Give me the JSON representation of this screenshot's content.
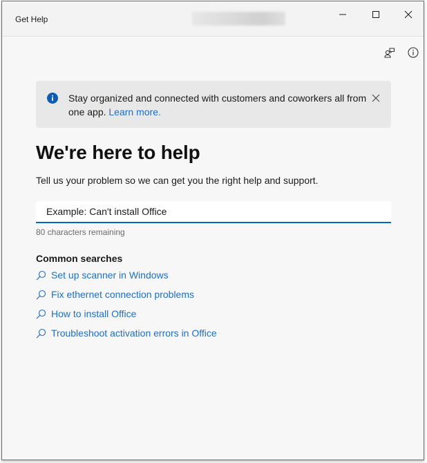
{
  "window": {
    "title": "Get Help",
    "controls": {
      "minimize": "minimize",
      "maximize": "maximize",
      "close": "close"
    }
  },
  "toolbar": {
    "icons": [
      "contact-support-icon",
      "info-icon"
    ]
  },
  "banner": {
    "icon": "info-icon",
    "text": "Stay organized and connected with customers and coworkers all from one app.",
    "link_label": "Learn more.",
    "close_icon": "close-icon"
  },
  "main": {
    "heading": "We're here to help",
    "subtitle": "Tell us your problem so we can get you the right help and support.",
    "search": {
      "value": "",
      "placeholder": "Example: Can't install Office",
      "chars_remaining": "80 characters remaining"
    },
    "common_searches": {
      "title": "Common searches",
      "items": [
        {
          "label": "Set up scanner in Windows",
          "icon": "search-icon"
        },
        {
          "label": "Fix ethernet connection problems",
          "icon": "search-icon"
        },
        {
          "label": "How to install Office",
          "icon": "search-icon"
        },
        {
          "label": "Troubleshoot activation errors in Office",
          "icon": "search-icon"
        }
      ]
    }
  },
  "colors": {
    "accent": "#0067c0",
    "link": "#1f6fc4",
    "banner_bg": "#e8e8e8",
    "window_bg": "#f7f7f7"
  }
}
